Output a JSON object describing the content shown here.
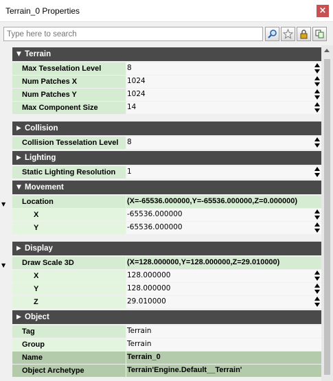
{
  "window": {
    "title": "Terrain_0 Properties",
    "close_glyph": "×"
  },
  "search": {
    "placeholder": "Type here to search"
  },
  "toolbar": {
    "icons": [
      "search-icon",
      "star-icon",
      "lock-icon",
      "copy-icon"
    ]
  },
  "categories": {
    "terrain": "Terrain",
    "collision": "Collision",
    "lighting": "Lighting",
    "movement": "Movement",
    "display": "Display",
    "object": "Object"
  },
  "props": {
    "max_tesselation_level": {
      "name": "Max Tesselation Level",
      "value": "8"
    },
    "num_patches_x": {
      "name": "Num Patches X",
      "value": "1024"
    },
    "num_patches_y": {
      "name": "Num Patches Y",
      "value": "1024"
    },
    "max_component_size": {
      "name": "Max Component Size",
      "value": "14"
    },
    "collision_tesselation_level": {
      "name": "Collision Tesselation Level",
      "value": "8"
    },
    "static_lighting_resolution": {
      "name": "Static Lighting Resolution",
      "value": "1"
    },
    "location": {
      "name": "Location",
      "value": "(X=-65536.000000,Y=-65536.000000,Z=0.000000)"
    },
    "location_x": {
      "name": "X",
      "value": "-65536.000000"
    },
    "location_y": {
      "name": "Y",
      "value": "-65536.000000"
    },
    "draw_scale_3d": {
      "name": "Draw Scale 3D",
      "value": "(X=128.000000,Y=128.000000,Z=29.010000)"
    },
    "scale_x": {
      "name": "X",
      "value": "128.000000"
    },
    "scale_y": {
      "name": "Y",
      "value": "128.000000"
    },
    "scale_z": {
      "name": "Z",
      "value": "29.010000"
    },
    "tag": {
      "name": "Tag",
      "value": "Terrain"
    },
    "group": {
      "name": "Group",
      "value": "Terrain"
    },
    "name": {
      "name": "Name",
      "value": "Terrain_0"
    },
    "object_archetype": {
      "name": "Object Archetype",
      "value": "Terrain'Engine.Default__Terrain'"
    }
  },
  "colors": {
    "category_header": "#4a4a4a",
    "property_name_bg": "#d6ecd2",
    "readonly_bg": "#b3cbaa",
    "close_button": "#c75050"
  }
}
